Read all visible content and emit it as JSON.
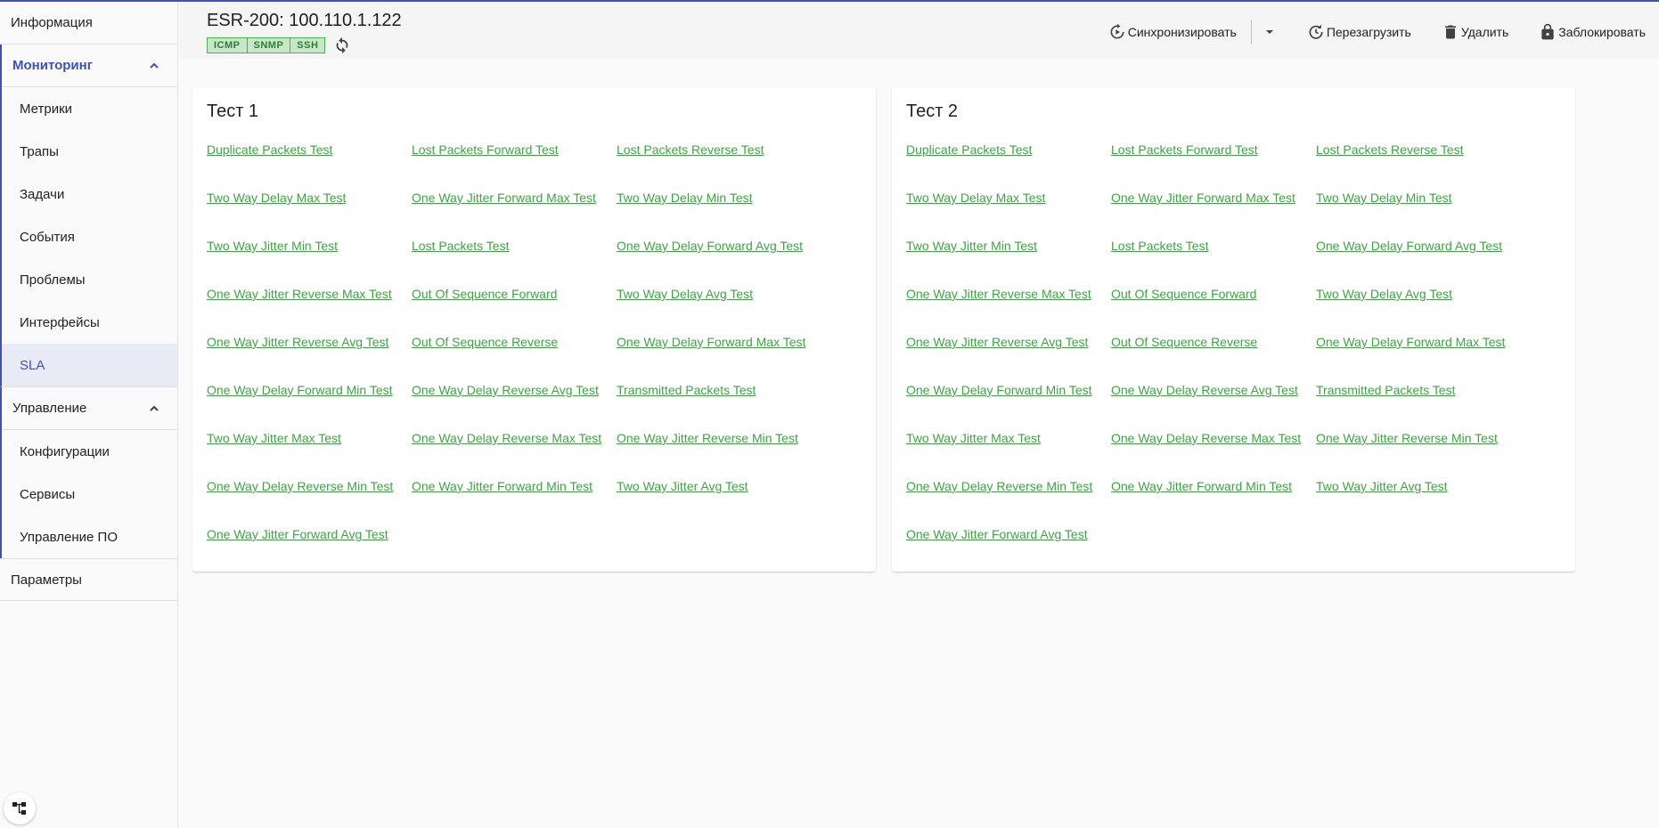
{
  "sidebar": {
    "info": "Информация",
    "monitoring": {
      "label": "Мониторинг",
      "items": [
        "Метрики",
        "Трапы",
        "Задачи",
        "События",
        "Проблемы",
        "Интерфейсы",
        "SLA"
      ]
    },
    "management": {
      "label": "Управление",
      "items": [
        "Конфигурации",
        "Сервисы",
        "Управление ПО"
      ]
    },
    "params": "Параметры"
  },
  "header": {
    "title": "ESR-200: 100.110.1.122",
    "badges": [
      "ICMP",
      "SNMP",
      "SSH"
    ],
    "actions": {
      "sync": "Синхронизировать",
      "reboot": "Перезагрузить",
      "delete": "Удалить",
      "lock": "Заблокировать"
    }
  },
  "tests": [
    {
      "title": "Тест 1",
      "links": [
        "Duplicate Packets Test",
        "Lost Packets Forward Test",
        "Lost Packets Reverse Test",
        "Two Way Delay Max Test",
        "One Way Jitter Forward Max Test",
        "Two Way Delay Min Test",
        "Two Way Jitter Min Test",
        "Lost Packets Test",
        "One Way Delay Forward Avg Test",
        "One Way Jitter Reverse Max Test",
        "Out Of Sequence Forward",
        "Two Way Delay Avg Test",
        "One Way Jitter Reverse Avg Test",
        "Out Of Sequence Reverse",
        "One Way Delay Forward Max Test",
        "One Way Delay Forward Min Test",
        "One Way Delay Reverse Avg Test",
        "Transmitted Packets Test",
        "Two Way Jitter Max Test",
        "One Way Delay Reverse Max Test",
        "One Way Jitter Reverse Min Test",
        "One Way Delay Reverse Min Test",
        "One Way Jitter Forward Min Test",
        "Two Way Jitter Avg Test",
        "One Way Jitter Forward Avg Test"
      ]
    },
    {
      "title": "Тест 2",
      "links": [
        "Duplicate Packets Test",
        "Lost Packets Forward Test",
        "Lost Packets Reverse Test",
        "Two Way Delay Max Test",
        "One Way Jitter Forward Max Test",
        "Two Way Delay Min Test",
        "Two Way Jitter Min Test",
        "Lost Packets Test",
        "One Way Delay Forward Avg Test",
        "One Way Jitter Reverse Max Test",
        "Out Of Sequence Forward",
        "Two Way Delay Avg Test",
        "One Way Jitter Reverse Avg Test",
        "Out Of Sequence Reverse",
        "One Way Delay Forward Max Test",
        "One Way Delay Forward Min Test",
        "One Way Delay Reverse Avg Test",
        "Transmitted Packets Test",
        "Two Way Jitter Max Test",
        "One Way Delay Reverse Max Test",
        "One Way Jitter Reverse Min Test",
        "One Way Delay Reverse Min Test",
        "One Way Jitter Forward Min Test",
        "Two Way Jitter Avg Test",
        "One Way Jitter Forward Avg Test"
      ]
    }
  ],
  "colors": {
    "accent": "#3f51b5",
    "link": "#43a047",
    "badge_bg": "#c8e6c9",
    "badge_text": "#2e7d32"
  }
}
